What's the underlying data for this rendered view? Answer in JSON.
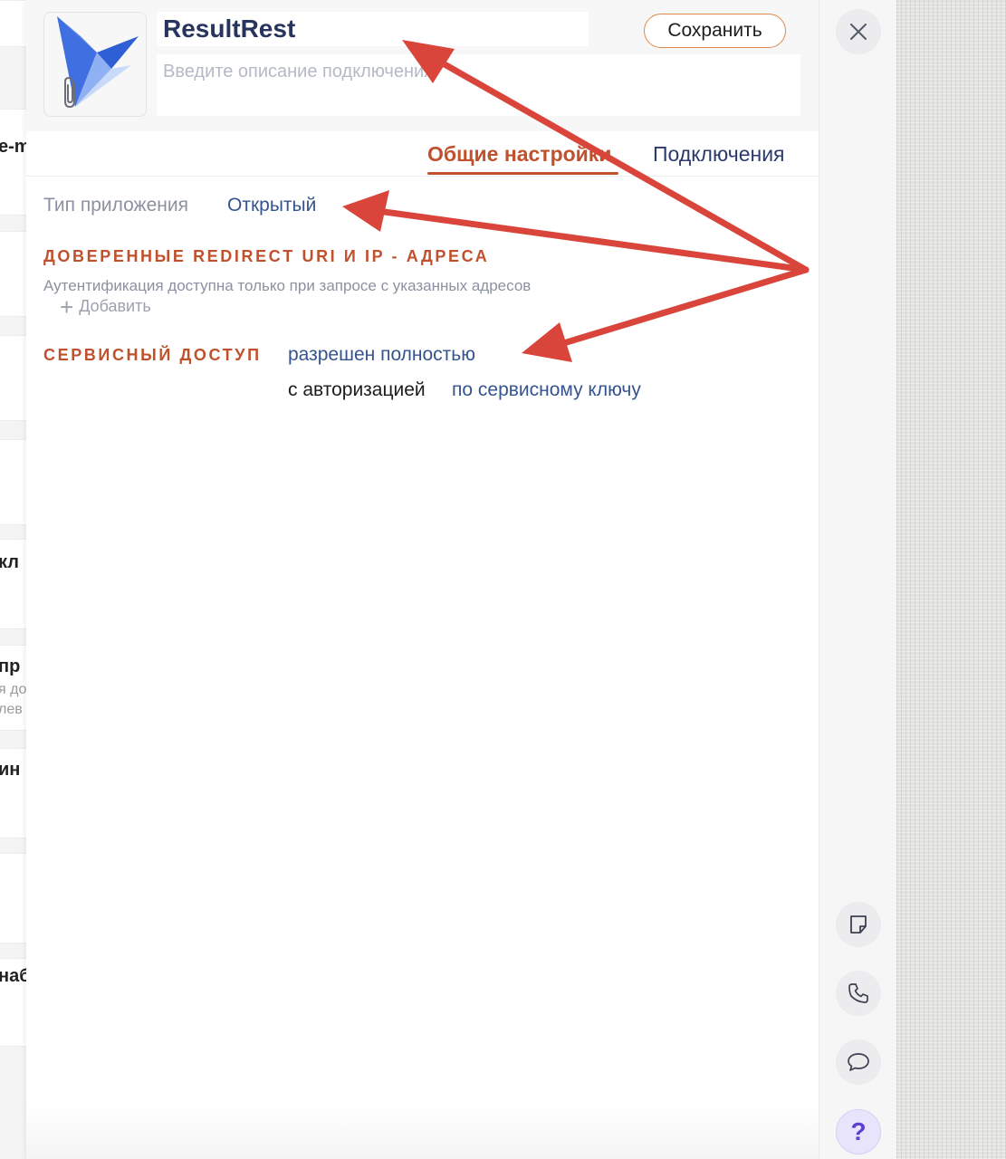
{
  "background_page": {
    "rows": [
      {
        "text": "e-m"
      },
      {
        "text": "кл"
      },
      {
        "text": "пр",
        "sub1": "я до",
        "sub2": "лев"
      },
      {
        "text": "ин"
      },
      {
        "text": "наб"
      }
    ]
  },
  "header": {
    "app_name": "ResultRest",
    "description_placeholder": "Введите описание подключения",
    "save_label": "Сохранить"
  },
  "tabs": [
    {
      "label": "Общие настройки",
      "active": true
    },
    {
      "label": "Подключения",
      "active": false
    }
  ],
  "general": {
    "app_type_label": "Тип приложения",
    "app_type_value": "Открытый",
    "trusted_title": "ДОВЕРЕННЫЕ REDIRECT URI И IP - АДРЕСА",
    "trusted_desc": "Аутентификация доступна только при запросе с указанных адресов",
    "add_label": "Добавить",
    "service_title": "СЕРВИСНЫЙ ДОСТУП",
    "service_value": "разрешен полностью",
    "auth_label": "с авторизацией",
    "auth_value": "по сервисному ключу"
  },
  "toolbar": {
    "close_icon": "close-icon",
    "note_icon": "note-icon",
    "phone_icon": "phone-icon",
    "chat_icon": "chat-icon",
    "help_label": "?"
  },
  "colors": {
    "accent": "#c0512c",
    "link": "#35548f",
    "annotation_arrow": "#d9453a"
  }
}
